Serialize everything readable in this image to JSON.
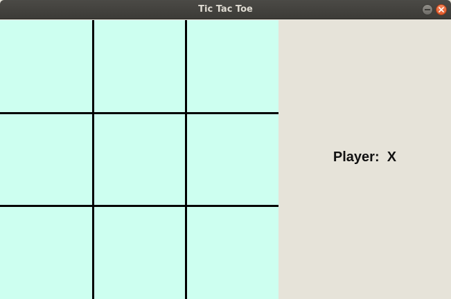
{
  "window": {
    "title": "Tic Tac Toe"
  },
  "board": {
    "cells": [
      [
        "",
        "",
        ""
      ],
      [
        "",
        "",
        ""
      ],
      [
        "",
        "",
        ""
      ]
    ],
    "background": "#cdfff0",
    "line_color": "#000000"
  },
  "status": {
    "label": "Player:",
    "current_player": "X"
  },
  "colors": {
    "panel": "#e6e3d9",
    "titlebar": "#3c3b37",
    "close_button": "#e05a2b"
  },
  "icons": {
    "minimize": "minimize-icon",
    "close": "close-icon"
  }
}
